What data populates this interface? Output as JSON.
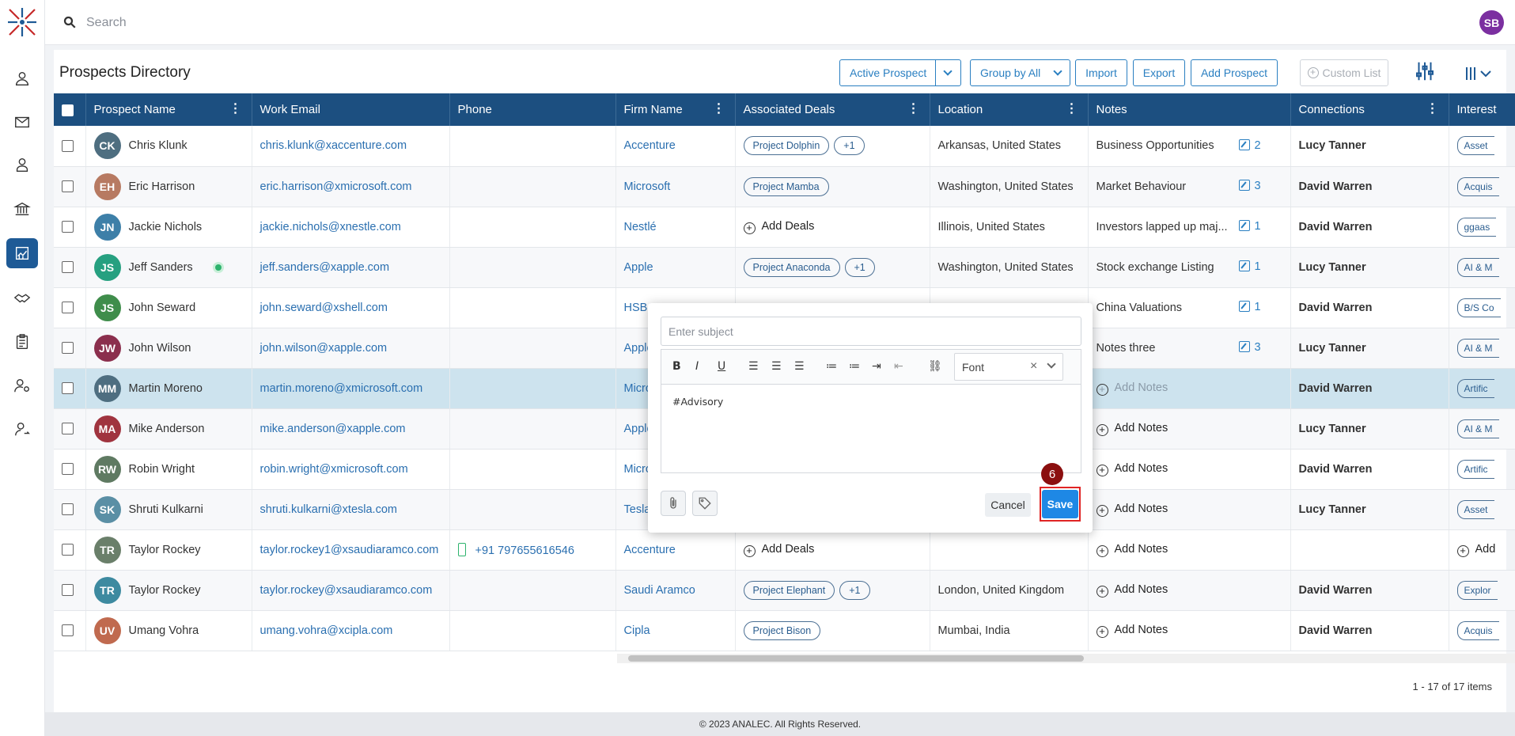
{
  "app": {
    "search_placeholder": "Search",
    "user_initials": "SB",
    "footer": "© 2023 ANALEC. All Rights Reserved."
  },
  "page": {
    "title": "Prospects Directory",
    "toolbar": {
      "active_prospect": "Active Prospect",
      "group_by": "Group by All",
      "import": "Import",
      "export": "Export",
      "add_prospect": "Add Prospect",
      "custom_list": "Custom List"
    },
    "pager": "1 - 17 of 17 items"
  },
  "columns": [
    "Prospect Name",
    "Work Email",
    "Phone",
    "Firm Name",
    "Associated Deals",
    "Location",
    "Notes",
    "Connections",
    "Interest"
  ],
  "rows": [
    {
      "initials": "CK",
      "color": "#4e6e80",
      "name": "Chris Klunk",
      "email": "chris.klunk@xaccenture.com",
      "phone": "",
      "firm": "Accenture",
      "deals": [
        "Project Dolphin",
        "+1"
      ],
      "location": "Arkansas, United States",
      "note": "Business Opportunities",
      "note_count": "2",
      "conn": "Lucy Tanner",
      "interest": "Asset"
    },
    {
      "initials": "EH",
      "color": "#b77a62",
      "name": "Eric Harrison",
      "email": "eric.harrison@xmicrosoft.com",
      "phone": "",
      "firm": "Microsoft",
      "deals": [
        "Project Mamba"
      ],
      "location": "Washington, United States",
      "note": "Market Behaviour",
      "note_count": "3",
      "conn": "David Warren",
      "interest": "Acquis"
    },
    {
      "initials": "JN",
      "color": "#3d7fa8",
      "name": "Jackie Nichols",
      "email": "jackie.nichols@xnestle.com",
      "phone": "",
      "firm": "Nestlé",
      "deals": [],
      "add_deals": "Add Deals",
      "location": "Illinois, United States",
      "note": "Investors lapped up maj...",
      "note_count": "1",
      "conn": "David Warren",
      "interest": "ggaas"
    },
    {
      "initials": "JS",
      "color": "#26a080",
      "name": "Jeff Sanders",
      "email": "jeff.sanders@xapple.com",
      "phone": "",
      "firm": "Apple",
      "deals": [
        "Project Anaconda",
        "+1"
      ],
      "location": "Washington, United States",
      "note": "Stock exchange Listing",
      "note_count": "1",
      "conn": "Lucy Tanner",
      "interest": "AI & M"
    },
    {
      "initials": "JS",
      "color": "#3f8d4b",
      "name": "John Seward",
      "email": "john.seward@xshell.com",
      "phone": "",
      "firm": "HSBC",
      "deals": [],
      "location": "",
      "note": "China Valuations",
      "note_count": "1",
      "conn": "David Warren",
      "interest": "B/S Co"
    },
    {
      "initials": "JW",
      "color": "#8b2f4d",
      "name": "John Wilson",
      "email": "john.wilson@xapple.com",
      "phone": "",
      "firm": "Apple",
      "deals": [],
      "location": "",
      "note": "Notes three",
      "note_count": "3",
      "conn": "Lucy Tanner",
      "interest": "AI & M"
    },
    {
      "initials": "MM",
      "color": "#4e6e80",
      "name": "Martin Moreno",
      "email": "martin.moreno@xmicrosoft.com",
      "phone": "",
      "firm": "Micro",
      "deals": [],
      "location": "",
      "note": "",
      "add_notes": "Add Notes",
      "conn": "David Warren",
      "interest": "Artific",
      "selected": true
    },
    {
      "initials": "MA",
      "color": "#a0343f",
      "name": "Mike Anderson",
      "email": "mike.anderson@xapple.com",
      "phone": "",
      "firm": "Apple",
      "deals": [],
      "location": "",
      "note": "",
      "add_notes": "Add Notes",
      "conn": "Lucy Tanner",
      "interest": "AI & M"
    },
    {
      "initials": "RW",
      "color": "#5f7a62",
      "name": "Robin Wright",
      "email": "robin.wright@xmicrosoft.com",
      "phone": "",
      "firm": "Micro",
      "deals": [],
      "location": "",
      "note": "",
      "add_notes": "Add Notes",
      "conn": "David Warren",
      "interest": "Artific"
    },
    {
      "initials": "SK",
      "color": "#5a8fa5",
      "name": "Shruti Kulkarni",
      "email": "shruti.kulkarni@xtesla.com",
      "phone": "",
      "firm": "Tesla",
      "deals": [],
      "location": "",
      "note": "",
      "add_notes": "Add Notes",
      "conn": "Lucy Tanner",
      "interest": "Asset"
    },
    {
      "initials": "TR",
      "color": "#6a7f6a",
      "name": "Taylor Rockey",
      "email": "taylor.rockey1@xsaudiaramco.com",
      "phone": "+91 797655616546",
      "firm": "Accenture",
      "deals": [],
      "add_deals": "Add Deals",
      "location": "",
      "note": "",
      "add_notes": "Add Notes",
      "conn": "",
      "interest": "Add"
    },
    {
      "initials": "TR",
      "color": "#3d8aa0",
      "name": "Taylor Rockey",
      "email": "taylor.rockey@xsaudiaramco.com",
      "phone": "",
      "firm": "Saudi Aramco",
      "deals": [
        "Project Elephant",
        "+1"
      ],
      "location": "London, United Kingdom",
      "note": "",
      "add_notes": "Add Notes",
      "conn": "David Warren",
      "interest": "Explor"
    },
    {
      "initials": "UV",
      "color": "#c06a4f",
      "name": "Umang Vohra",
      "email": "umang.vohra@xcipla.com",
      "phone": "",
      "firm": "Cipla",
      "deals": [
        "Project Bison"
      ],
      "location": "Mumbai, India",
      "note": "",
      "add_notes": "Add Notes",
      "conn": "David Warren",
      "interest": "Acquis"
    }
  ],
  "popup": {
    "subject_placeholder": "Enter subject",
    "font_label": "Font",
    "body": "#Advisory",
    "cancel": "Cancel",
    "save": "Save",
    "step": "6"
  }
}
